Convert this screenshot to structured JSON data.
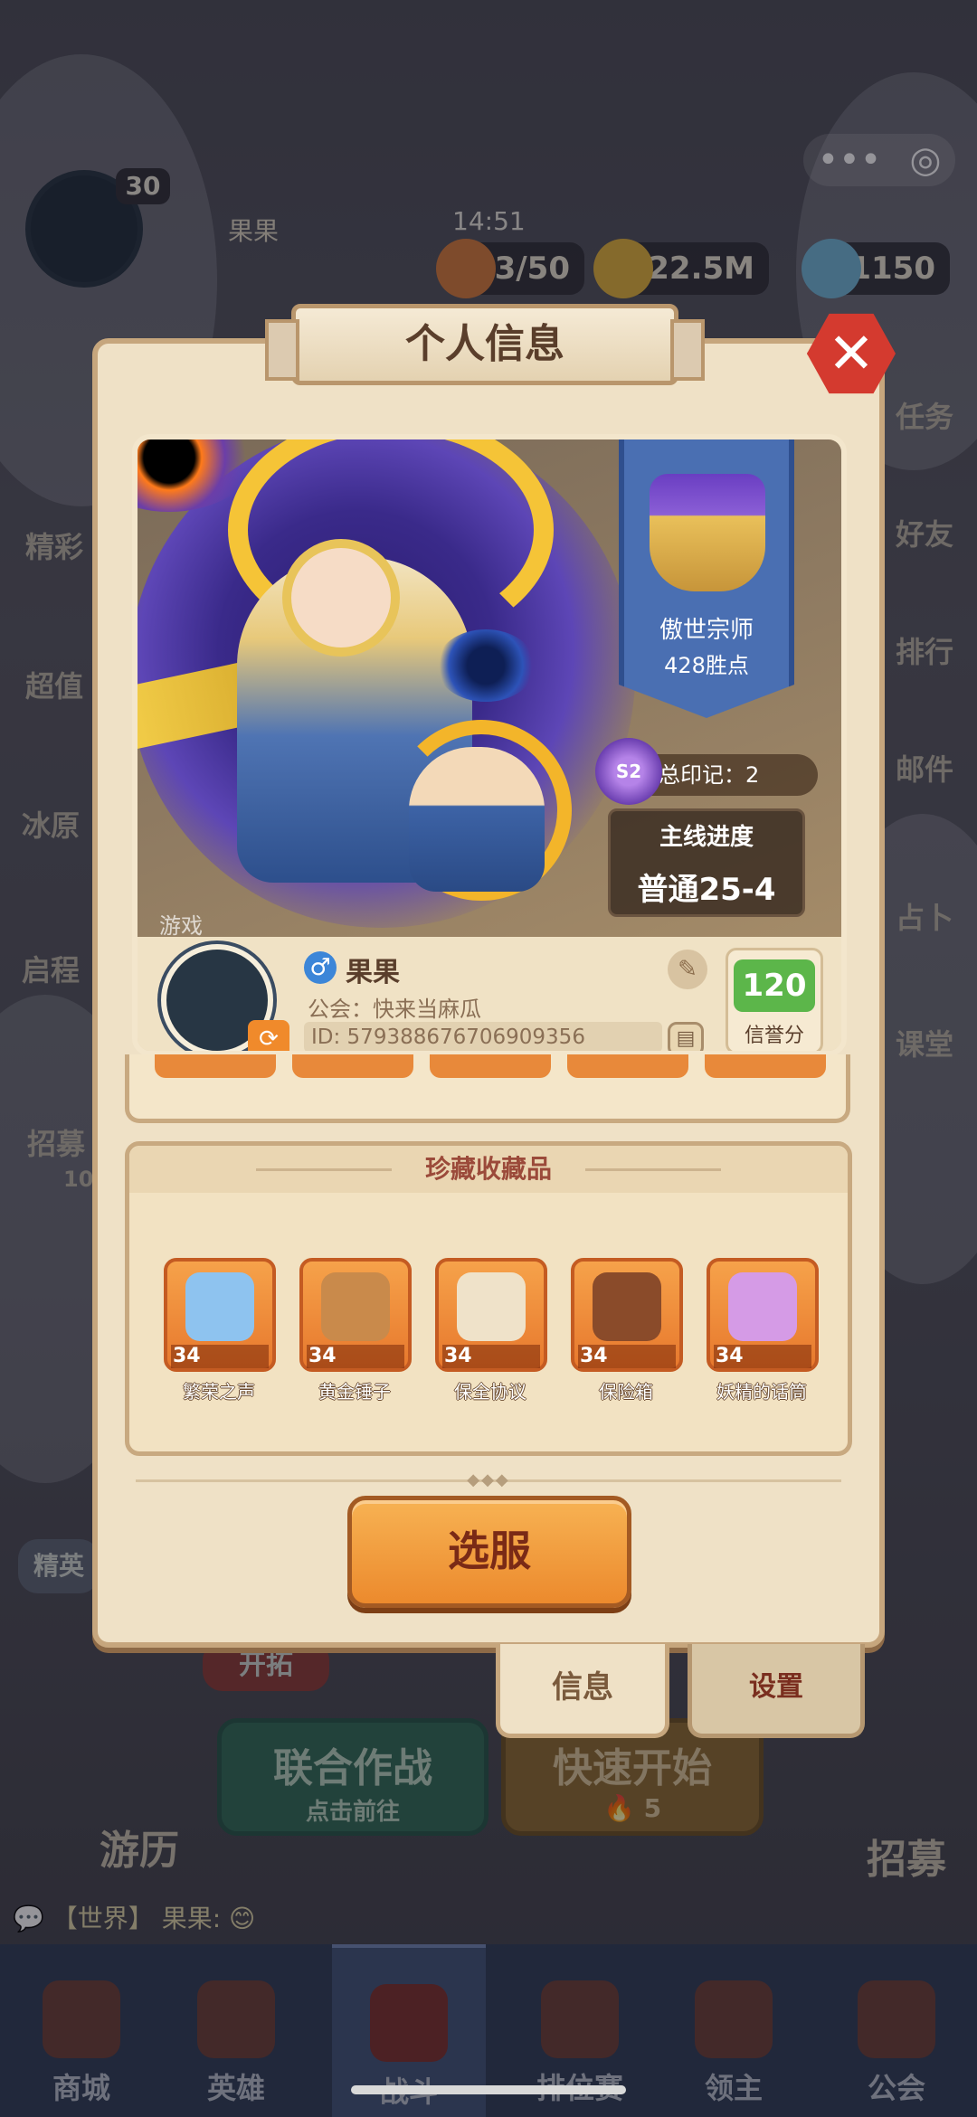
{
  "hud": {
    "level": "30",
    "player_name": "果果",
    "time": "14:51",
    "stamina": "13/50",
    "gold": "22.5M",
    "gems": "1150",
    "menu_icon": "more-dots-icon",
    "target_icon": "target-icon"
  },
  "side_left": [
    "精彩",
    "超值",
    "冰原",
    "启程",
    "招募"
  ],
  "side_right": [
    "任务",
    "好友",
    "排行",
    "邮件",
    "占卜",
    "课堂"
  ],
  "modal": {
    "title": "个人信息",
    "close_icon": "close-icon",
    "rank": {
      "name": "傲世宗师",
      "points": "428胜点"
    },
    "seal": {
      "badge": "S2",
      "label": "总印记：2"
    },
    "progress": {
      "label": "主线进度",
      "value": "普通25-4"
    },
    "watermark": "游戏",
    "profile": {
      "gender_icon": "male-icon",
      "name": "果果",
      "guild": "公会：快来当麻瓜",
      "id": "ID: 579388676706909356",
      "credit_value": "120",
      "credit_label": "信誉分"
    },
    "collection": {
      "title": "珍藏收藏品",
      "items": [
        {
          "name": "繁荣之声",
          "level": "34",
          "color": "#8ec3ef"
        },
        {
          "name": "黄金锤子",
          "level": "34",
          "color": "#c98a4b"
        },
        {
          "name": "保全协议",
          "level": "34",
          "color": "#efe2c9"
        },
        {
          "name": "保险箱",
          "level": "34",
          "color": "#8a4b2a"
        },
        {
          "name": "妖精的话筒",
          "level": "34",
          "color": "#d59be6"
        }
      ]
    },
    "select_button": "选服",
    "tabs": {
      "info": "信息",
      "settings": "设置"
    }
  },
  "background": {
    "elite": "精英",
    "expand": "开拓",
    "coop_title": "联合作战",
    "coop_sub": "点击前往",
    "quick_title": "快速开始",
    "quick_cost": "5",
    "travel": "游历",
    "recruit": "招募",
    "recruit_timer": "10"
  },
  "chat": {
    "channel": "【世界】",
    "text": "果果: 😊"
  },
  "nav": [
    {
      "label": "商城"
    },
    {
      "label": "英雄"
    },
    {
      "label": "战斗"
    },
    {
      "label": "排位赛"
    },
    {
      "label": "领主"
    },
    {
      "label": "公会"
    }
  ]
}
